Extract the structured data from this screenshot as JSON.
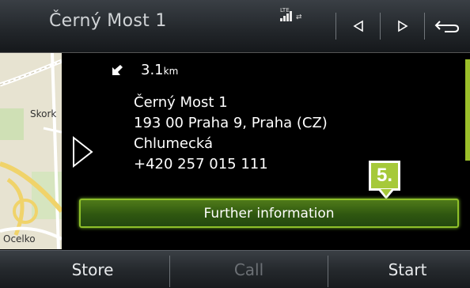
{
  "header": {
    "title": "Černý Most 1",
    "signal_label": "LTE",
    "buttons": [
      {
        "icon": "triangle-left-icon"
      },
      {
        "icon": "triangle-right-icon"
      },
      {
        "icon": "back-arrow-icon"
      }
    ]
  },
  "map": {
    "labels": [
      "Skork",
      "Ocelko"
    ]
  },
  "destination": {
    "distance_value": "3.1",
    "distance_unit": "km",
    "lines": [
      "Černý Most 1",
      "193 00 Praha 9, Praha (CZ)",
      "Chlumecká",
      "+420 257 015 111"
    ]
  },
  "callout": {
    "label": "5."
  },
  "further_button": {
    "label": "Further information"
  },
  "footer": {
    "store_label": "Store",
    "call_label": "Call",
    "start_label": "Start"
  },
  "colors": {
    "accent_green": "#8fc02a",
    "callout_green": "#a6c93a"
  }
}
